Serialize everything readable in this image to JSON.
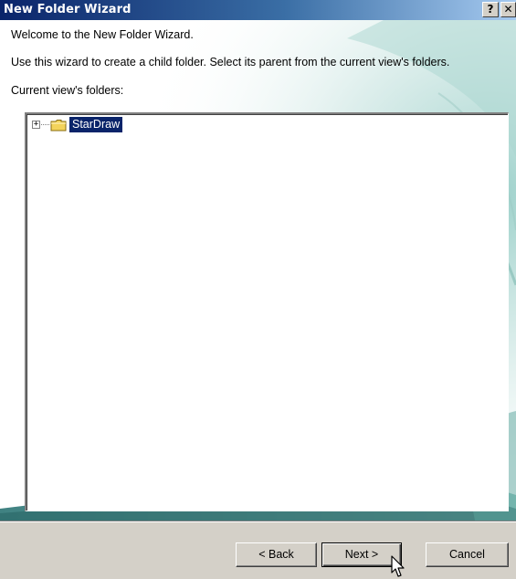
{
  "window": {
    "title": "New Folder Wizard",
    "help_button": "?",
    "close_button": "✕"
  },
  "intro": {
    "welcome": "Welcome to the New Folder Wizard.",
    "instruction": "Use this wizard to create a child folder. Select its parent from the current view's folders.",
    "folders_label": "Current view's folders:"
  },
  "tree": {
    "items": [
      {
        "label": "StarDraw",
        "expander": "+",
        "icon": "folder-icon",
        "selected": true
      }
    ]
  },
  "buttons": {
    "back": "< Back",
    "next": "Next >",
    "cancel": "Cancel"
  },
  "colors": {
    "title_gradient_start": "#0a246a",
    "title_gradient_end": "#a6caf0",
    "selection": "#0a246a",
    "dialog_face": "#d4d0c8",
    "art_teal": "#2f8f8f"
  }
}
